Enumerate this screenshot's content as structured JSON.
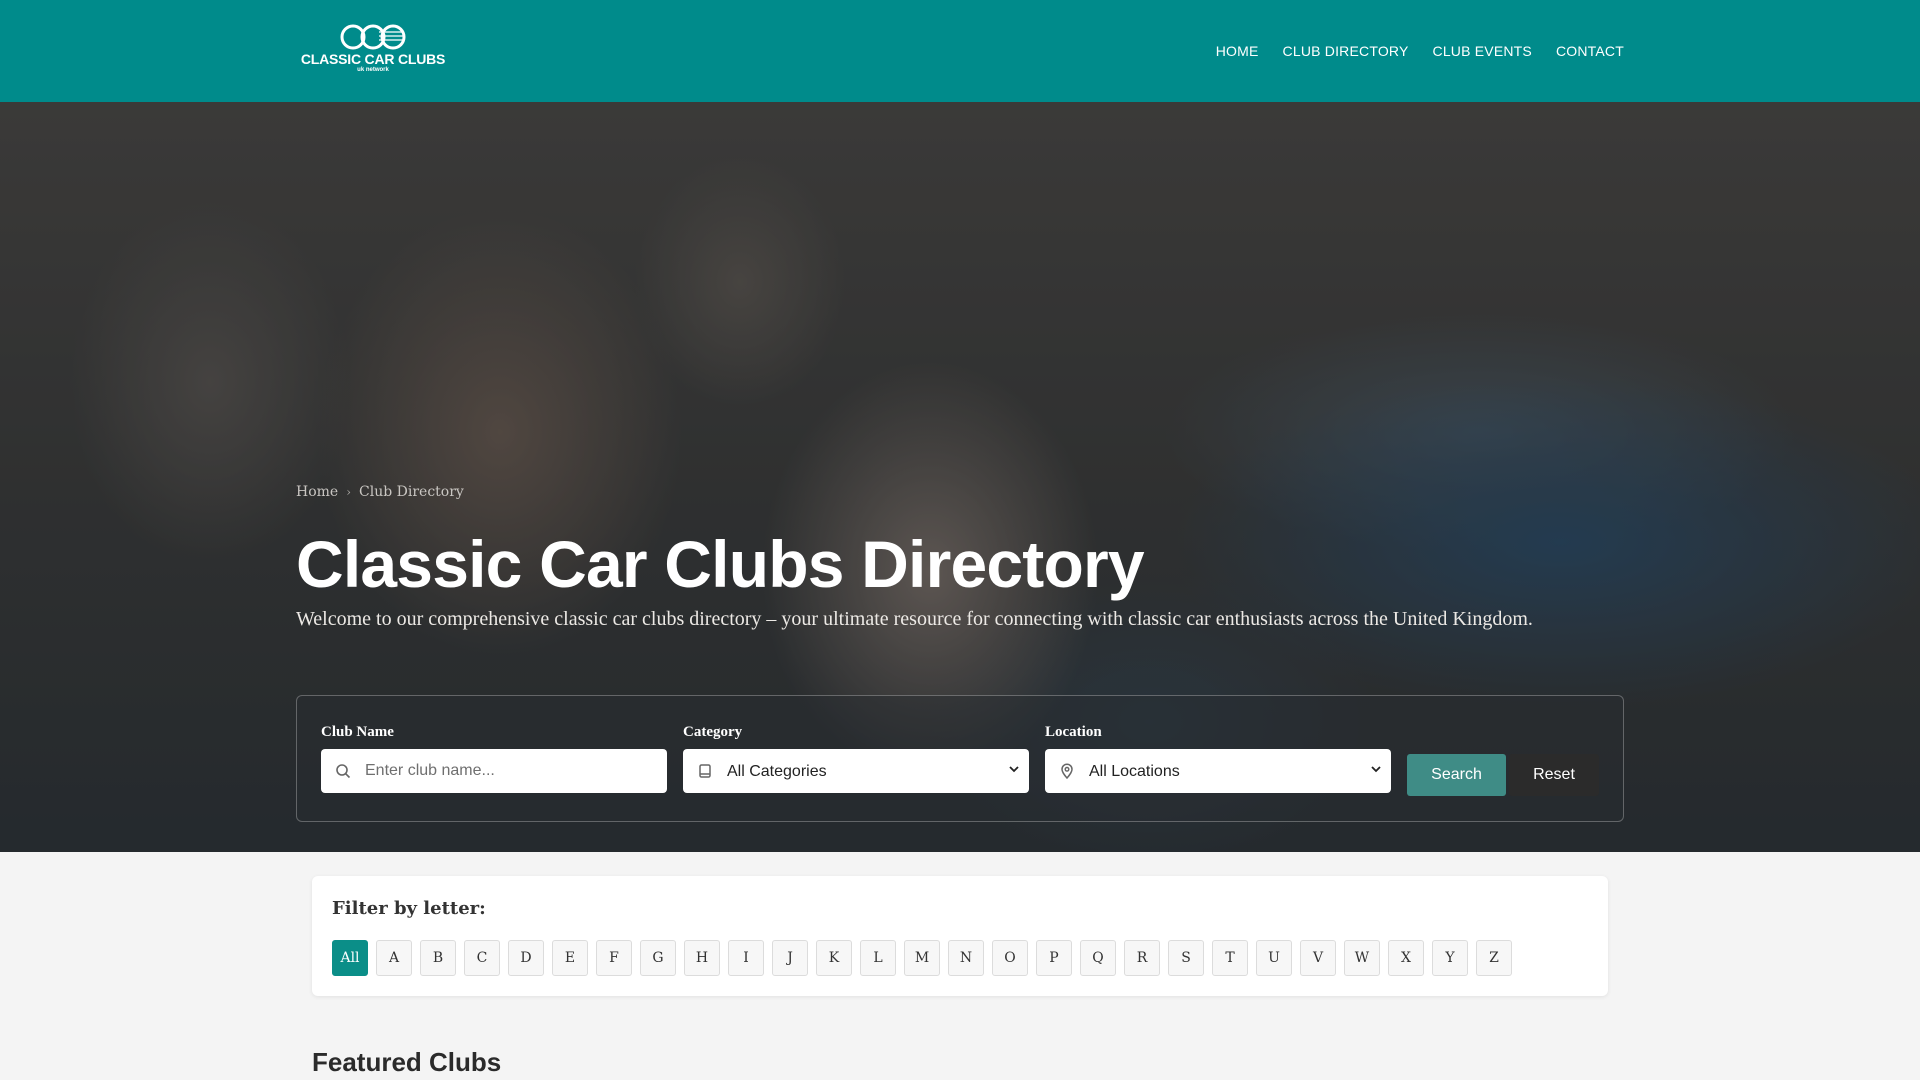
{
  "brand": {
    "name": "CLASSIC CAR CLUBS",
    "tagline": "uk network"
  },
  "nav": {
    "items": [
      {
        "label": "HOME"
      },
      {
        "label": "CLUB DIRECTORY"
      },
      {
        "label": "CLUB EVENTS"
      },
      {
        "label": "CONTACT"
      }
    ]
  },
  "hero": {
    "breadcrumb": {
      "home": "Home",
      "current": "Club Directory"
    },
    "title": "Classic Car Clubs Directory",
    "intro": "Welcome to our comprehensive classic car clubs directory – your ultimate resource for connecting with classic car enthusiasts across the United Kingdom."
  },
  "search": {
    "club_name": {
      "label": "Club Name",
      "placeholder": "Enter club name...",
      "value": "",
      "icon": "search-icon"
    },
    "category": {
      "label": "Category",
      "selected": "All Categories",
      "icon": "book-icon"
    },
    "location": {
      "label": "Location",
      "selected": "All Locations",
      "icon": "map-pin-icon"
    },
    "search_button": "Search",
    "reset_button": "Reset"
  },
  "filter": {
    "title": "Filter by letter:",
    "letters": [
      "All",
      "A",
      "B",
      "C",
      "D",
      "E",
      "F",
      "G",
      "H",
      "I",
      "J",
      "K",
      "L",
      "M",
      "N",
      "O",
      "P",
      "Q",
      "R",
      "S",
      "T",
      "U",
      "V",
      "W",
      "X",
      "Y",
      "Z"
    ],
    "active": "All"
  },
  "featured": {
    "title": "Featured Clubs"
  },
  "colors": {
    "header": "#008b8b",
    "accent": "#0b8e88",
    "search_button": "#3f8c86",
    "reset_button": "#2b2b2b"
  }
}
